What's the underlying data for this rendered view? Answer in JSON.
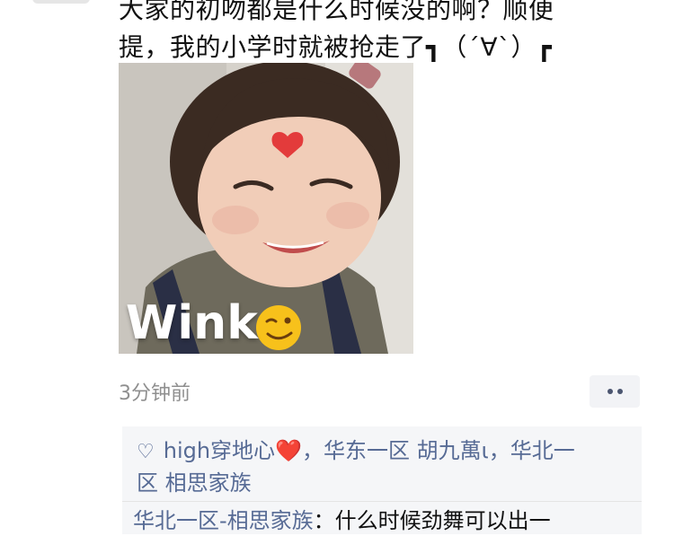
{
  "post": {
    "text_line1": "大家的初吻都是什么时候没的啊？顺便",
    "text_line2": "提，我的小学时就被抢走了┓（´∀`）┏",
    "image_caption": "Wink",
    "time": "3分钟前"
  },
  "likes": {
    "prefix": "high穿地心",
    "heart": "❤️",
    "rest_line1": "，华东一区  胡九萬ι，华北一",
    "rest_line2": "区  相思家族"
  },
  "comment": {
    "author": "华北一区-相思家族",
    "separator": "：",
    "text": "什么时候劲舞可以出一"
  }
}
